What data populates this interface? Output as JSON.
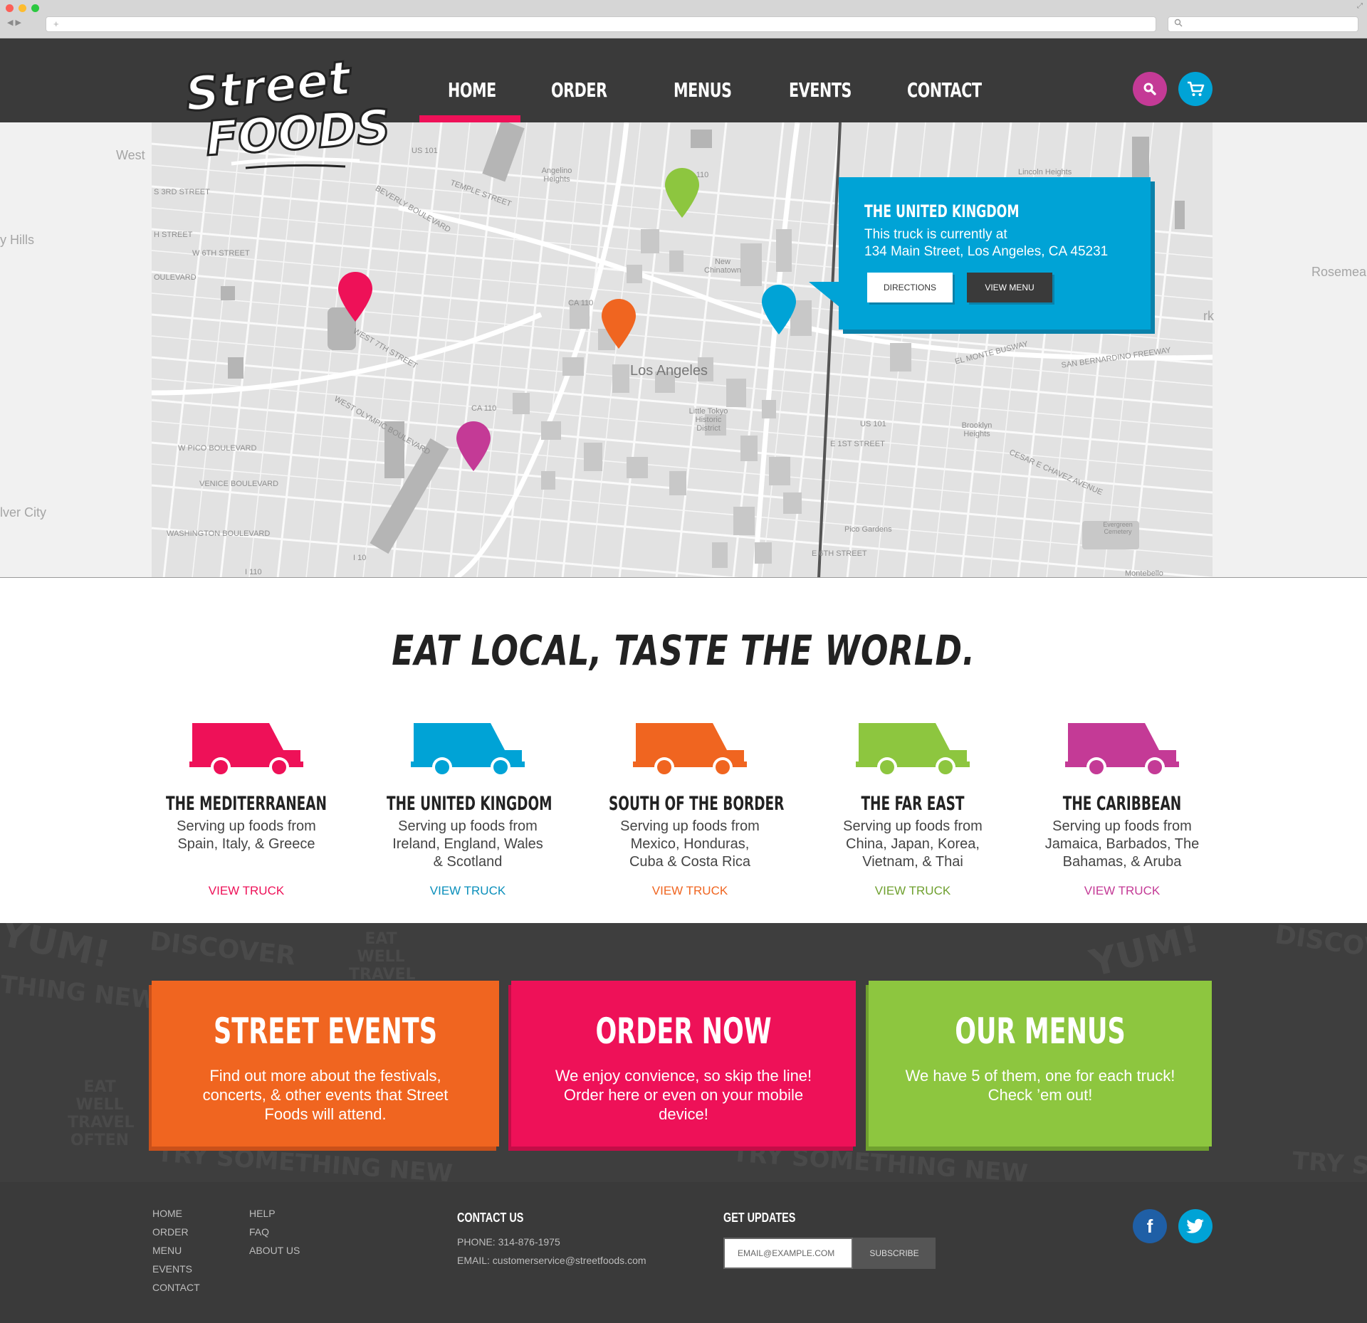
{
  "chrome": {
    "new_tab_symbol": "+",
    "nav_arrows": "◀ ▶"
  },
  "header": {
    "logo_lines": [
      "Street",
      "FOODS"
    ],
    "nav": [
      {
        "label": "HOME",
        "active": true
      },
      {
        "label": "ORDER",
        "active": false
      },
      {
        "label": "MENUS",
        "active": false
      },
      {
        "label": "EVENTS",
        "active": false
      },
      {
        "label": "CONTACT",
        "active": false
      }
    ],
    "search_icon": "search-icon",
    "cart_icon": "cart-icon",
    "colors": {
      "bar": "#3a3a3a",
      "active": "#ee1158",
      "search": "#c43a96",
      "cart": "#00a3d6"
    }
  },
  "map": {
    "labels": {
      "city": "Los Angeles",
      "west": "West",
      "hills": "y Hills",
      "culver": "lver City",
      "rosemead": "Rosemea",
      "york": "rk",
      "chinatown": "New Chinatown",
      "angelino": "Angelino Heights",
      "lincoln": "Lincoln Heights",
      "little_tokyo": "Little Tokyo Historic District",
      "brooklyn": "Brooklyn Heights",
      "pico": "Pico Gardens",
      "evergreen": "Evergreen Cemetery",
      "montebello": "Montebello",
      "s3rd": "S 3RD STREET",
      "s8th": "H STREET",
      "w6th": "W 6TH STREET",
      "boulevard": "OULEVARD",
      "west7": "WEST 7TH STREET",
      "wpico": "W PICO BOULEVARD",
      "venice": "VENICE BOULEVARD",
      "washington": "WASHINGTON BOULEVARD",
      "el_monte": "EL MONTE BUSWAY",
      "sb_freeway": "SAN BERNARDINO FREEWAY",
      "temple": "TEMPLE STREET",
      "beverly": "BEVERLY BOULEVARD",
      "olympic": "WEST OLYMPIC BOULEVARD",
      "us101_a": "US 101",
      "us101_b": "US 101",
      "ca110_a": "CA 110",
      "ca110_b": "CA 110",
      "ca110_c": "CA 110",
      "i10": "I 10",
      "i110": "I 110",
      "e1st": "E 1ST STREET",
      "cesar": "CESAR E CHAVEZ AVENUE",
      "e6th": "E 6TH STREET"
    },
    "pins": [
      {
        "name": "pin-mediterranean",
        "color": "#ee1158"
      },
      {
        "name": "pin-united-kingdom",
        "color": "#00a3d6"
      },
      {
        "name": "pin-south-of-the-border",
        "color": "#f06520"
      },
      {
        "name": "pin-far-east",
        "color": "#8dc63f"
      },
      {
        "name": "pin-caribbean",
        "color": "#c43a96"
      }
    ],
    "popup": {
      "title": "THE UNITED KINGDOM",
      "line1": "This truck is currently at",
      "line2": "134 Main Street, Los Angeles, CA 45231",
      "directions_label": "DIRECTIONS",
      "view_menu_label": "VIEW MENU"
    }
  },
  "tagline": "EAT LOCAL, TASTE THE WORLD.",
  "trucks": [
    {
      "name": "THE MEDITERRANEAN",
      "desc": "Serving up foods from Spain, Italy, & Greece",
      "link": "VIEW TRUCK",
      "color": "#ee1158"
    },
    {
      "name": "THE UNITED KINGDOM",
      "desc": "Serving up foods from Ireland, England, Wales & Scotland",
      "link": "VIEW TRUCK",
      "color": "#00a3d6"
    },
    {
      "name": "SOUTH OF THE BORDER",
      "desc": "Serving up foods from Mexico, Honduras, Cuba & Costa Rica",
      "link": "VIEW TRUCK",
      "color": "#f06520"
    },
    {
      "name": "THE FAR EAST",
      "desc": "Serving up foods from China, Japan, Korea, Vietnam, & Thai",
      "link": "VIEW TRUCK",
      "color": "#8dc63f"
    },
    {
      "name": "THE CARIBBEAN",
      "desc": "Serving up foods from Jamaica, Barbados, The Bahamas, & Aruba",
      "link": "VIEW TRUCK",
      "color": "#c43a96"
    }
  ],
  "promo": {
    "doodles": [
      "YUM!",
      "DISCOVER",
      "EAT WELL TRAVEL OFTEN",
      "TRY SOMETHING NEW",
      "THING NEW",
      "EAT WELL TRAVEL OFTEN",
      "TRY SOMETHING NEW",
      "DISCOVER",
      "YUM!",
      "TRY S"
    ],
    "cards": [
      {
        "title": "STREET EVENTS",
        "text": "Find out more about the festivals, concerts, & other events  that Street Foods will attend.",
        "color": "#f06520",
        "shadow": "#c9501a"
      },
      {
        "title": "ORDER NOW",
        "text": "We enjoy convience, so skip the line! Order here or even on your mobile device!",
        "color": "#ee1158",
        "shadow": "#c30d47"
      },
      {
        "title": "OUR MENUS",
        "text": "We have 5 of them, one for each truck! Check ’em out!",
        "color": "#8dc63f",
        "shadow": "#6fa02f"
      }
    ]
  },
  "footer": {
    "col1": [
      "HOME",
      "ORDER",
      "MENU",
      "EVENTS",
      "CONTACT"
    ],
    "col2": [
      "HELP",
      "FAQ",
      "ABOUT US"
    ],
    "contact_heading": "CONTACT US",
    "phone": "PHONE: 314-876-1975",
    "email": "EMAIL: customerservice@streetfoods.com",
    "updates_heading": "GET UPDATES",
    "email_placeholder": "EMAIL@EXAMPLE.COM",
    "subscribe_label": "SUBSCRIBE",
    "facebook_glyph": "f",
    "social_icons": [
      "facebook-icon",
      "twitter-icon"
    ],
    "colors": {
      "facebook": "#1f5fa6",
      "twitter": "#00a3d6"
    }
  }
}
